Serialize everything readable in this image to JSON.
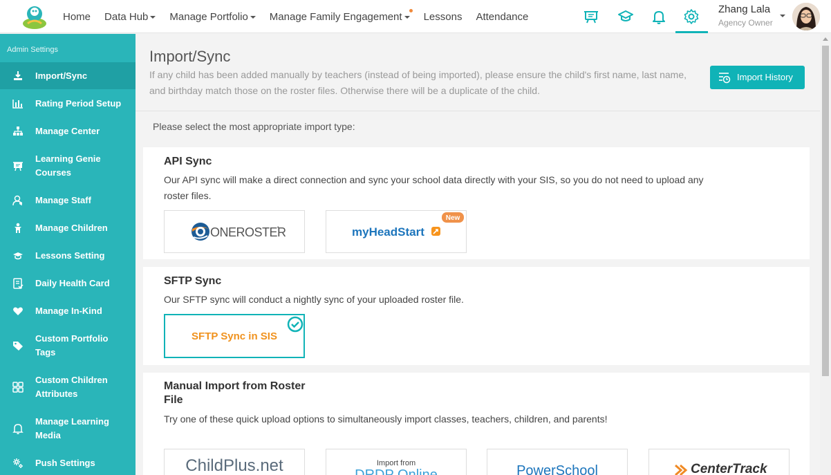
{
  "nav": {
    "items": [
      {
        "label": "Home",
        "dropdown": false,
        "dot": false
      },
      {
        "label": "Data Hub",
        "dropdown": true,
        "dot": false
      },
      {
        "label": "Manage Portfolio",
        "dropdown": true,
        "dot": false
      },
      {
        "label": "Manage Family Engagement",
        "dropdown": true,
        "dot": true
      },
      {
        "label": "Lessons",
        "dropdown": false,
        "dot": false
      },
      {
        "label": "Attendance",
        "dropdown": false,
        "dot": false
      }
    ],
    "icons": [
      "presentation-board-icon",
      "graduation-cap-icon",
      "bell-icon",
      "gear-icon"
    ],
    "user_name": "Zhang Lala",
    "user_role": "Agency Owner"
  },
  "colors": {
    "accent": "#10b3b7",
    "sidebar": "#2ab5b9",
    "sidebar_active": "#1fa0a4",
    "sftp_text": "#f0921e",
    "new_badge": "#f0924a"
  },
  "sidebar": {
    "title": "Admin Settings",
    "items": [
      {
        "label": "Import/Sync",
        "icon": "import-icon",
        "active": true
      },
      {
        "label": "Rating Period Setup",
        "icon": "bar-chart-icon",
        "active": false
      },
      {
        "label": "Manage Center",
        "icon": "org-chart-icon",
        "active": false
      },
      {
        "label": "Learning Genie Courses",
        "icon": "course-board-icon",
        "active": false
      },
      {
        "label": "Manage Staff",
        "icon": "staff-icon",
        "active": false
      },
      {
        "label": "Manage Children",
        "icon": "child-icon",
        "active": false
      },
      {
        "label": "Lessons Setting",
        "icon": "graduation-cap-icon",
        "active": false
      },
      {
        "label": "Daily Health Card",
        "icon": "health-card-icon",
        "active": false
      },
      {
        "label": "Manage In-Kind",
        "icon": "heart-icon",
        "active": false
      },
      {
        "label": "Custom Portfolio Tags",
        "icon": "tag-icon",
        "active": false
      },
      {
        "label": "Custom Children Attributes",
        "icon": "grid-icon",
        "active": false
      },
      {
        "label": "Manage Learning Media",
        "icon": "bell-icon",
        "active": false
      },
      {
        "label": "Push Settings",
        "icon": "cog-icon",
        "active": false
      }
    ]
  },
  "main": {
    "title": "Import/Sync",
    "description": "If any child has been added manually by teachers (instead of being imported), please ensure the child's first name, last name, and birthday match those on the roster files. Otherwise there will be a duplicate of the child.",
    "history_button": "Import History",
    "select_prompt": "Please select the most appropriate import type:",
    "api": {
      "title": "API Sync",
      "description": "Our API sync will make a direct connection and sync your school data directly with your SIS, so you do not need to upload any roster files.",
      "options": [
        {
          "label": "ONEROSTER",
          "logo_name": "oneroster-logo"
        },
        {
          "label": "myHeadStart",
          "logo_name": "myheadstart-logo",
          "badge": "New"
        }
      ]
    },
    "sftp": {
      "title": "SFTP Sync",
      "description": "Our SFTP sync will conduct a nightly sync of your uploaded roster file.",
      "option_label": "SFTP Sync in SIS"
    },
    "manual": {
      "title": "Manual Import from Roster File",
      "description": "Try one of these quick upload options to simultaneously import classes, teachers, children, and parents!",
      "options": [
        {
          "label": "ChildPlus.net",
          "logo_name": "childplus-logo"
        },
        {
          "sub_label": "Import from",
          "label": "DRDP Online",
          "logo_name": "drdp-logo"
        },
        {
          "label": "PowerSchool",
          "logo_name": "powerschool-logo"
        },
        {
          "label": "CenterTrack",
          "logo_name": "centertrack-logo"
        }
      ]
    }
  }
}
